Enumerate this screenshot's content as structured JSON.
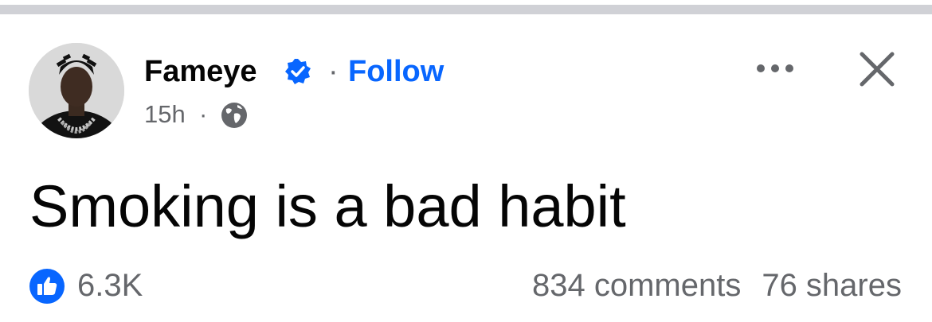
{
  "post": {
    "author": "Fameye",
    "separator": "·",
    "follow_label": "Follow",
    "time": "15h",
    "meta_separator": "·",
    "text": "Smoking is a bad habit",
    "likes": "6.3K",
    "comments": "834 comments",
    "shares": "76 shares"
  },
  "icons": {
    "verified": "verified-badge-icon",
    "audience": "globe-icon",
    "more": "more-options-icon",
    "close": "close-icon",
    "like": "like-thumb-icon"
  },
  "colors": {
    "accent": "#0866ff",
    "secondary_text": "#65676b",
    "primary_text": "#050505",
    "divider": "#d0d1d6"
  }
}
